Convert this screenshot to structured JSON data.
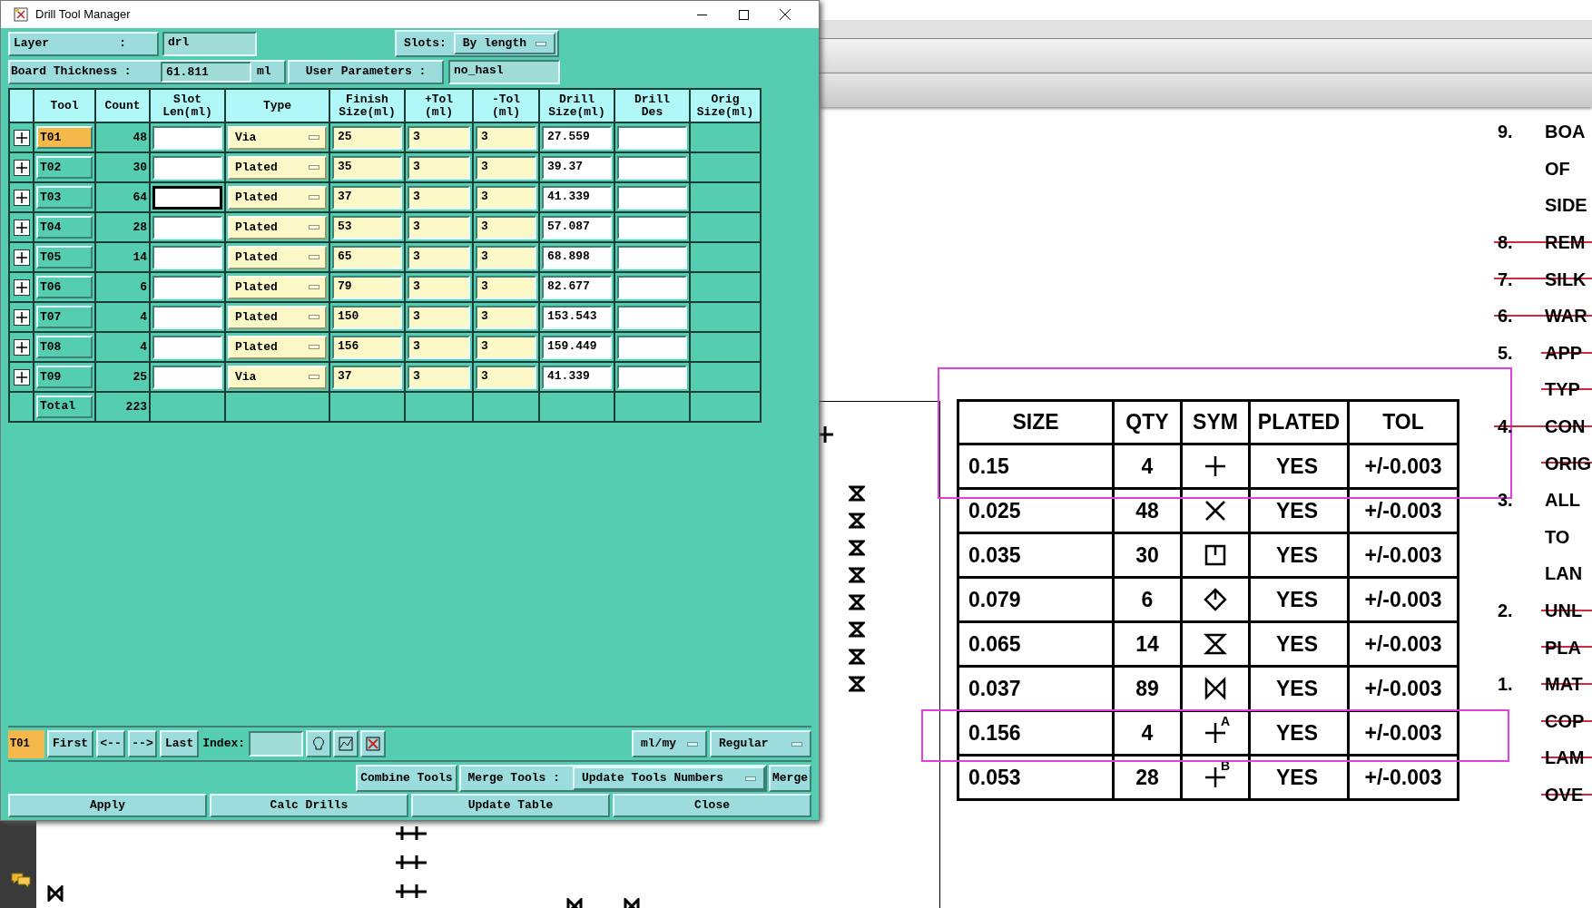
{
  "window": {
    "title": "Drill Tool Manager"
  },
  "layer": {
    "label": "Layer",
    "separator": ":",
    "value": "drl"
  },
  "slots": {
    "label": "Slots:",
    "value": "By length"
  },
  "board_thickness": {
    "label": "Board Thickness :",
    "value": "61.811",
    "unit": "ml"
  },
  "user_parameters": {
    "label": "User Parameters :",
    "value": "no_hasl"
  },
  "table": {
    "columns": [
      "Tool",
      "Count",
      "Slot\nLen(ml)",
      "Type",
      "Finish\nSize(ml)",
      "+Tol\n(ml)",
      "-Tol\n(ml)",
      "Drill\nSize(ml)",
      "Drill\nDes",
      "Orig\nSize(ml)"
    ],
    "rows": [
      {
        "tool": "T01",
        "selected": true,
        "count": "48",
        "slot_focused": false,
        "type": "Via",
        "finish": "25",
        "plus_tol": "3",
        "minus_tol": "3",
        "drill_size": "27.559"
      },
      {
        "tool": "T02",
        "selected": false,
        "count": "30",
        "slot_focused": false,
        "type": "Plated",
        "finish": "35",
        "plus_tol": "3",
        "minus_tol": "3",
        "drill_size": "39.37"
      },
      {
        "tool": "T03",
        "selected": false,
        "count": "64",
        "slot_focused": true,
        "type": "Plated",
        "finish": "37",
        "plus_tol": "3",
        "minus_tol": "3",
        "drill_size": "41.339"
      },
      {
        "tool": "T04",
        "selected": false,
        "count": "28",
        "slot_focused": false,
        "type": "Plated",
        "finish": "53",
        "plus_tol": "3",
        "minus_tol": "3",
        "drill_size": "57.087"
      },
      {
        "tool": "T05",
        "selected": false,
        "count": "14",
        "slot_focused": false,
        "type": "Plated",
        "finish": "65",
        "plus_tol": "3",
        "minus_tol": "3",
        "drill_size": "68.898"
      },
      {
        "tool": "T06",
        "selected": false,
        "count": "6",
        "slot_focused": false,
        "type": "Plated",
        "finish": "79",
        "plus_tol": "3",
        "minus_tol": "3",
        "drill_size": "82.677"
      },
      {
        "tool": "T07",
        "selected": false,
        "count": "4",
        "slot_focused": false,
        "type": "Plated",
        "finish": "150",
        "plus_tol": "3",
        "minus_tol": "3",
        "drill_size": "153.543"
      },
      {
        "tool": "T08",
        "selected": false,
        "count": "4",
        "slot_focused": false,
        "type": "Plated",
        "finish": "156",
        "plus_tol": "3",
        "minus_tol": "3",
        "drill_size": "159.449"
      },
      {
        "tool": "T09",
        "selected": false,
        "count": "25",
        "slot_focused": false,
        "type": "Via",
        "finish": "37",
        "plus_tol": "3",
        "minus_tol": "3",
        "drill_size": "41.339"
      }
    ],
    "total": {
      "label": "Total",
      "count": "223"
    }
  },
  "navigation": {
    "current_tool": "T01",
    "buttons": [
      "First",
      "<--",
      "-->",
      "Last"
    ],
    "index_label": "Index:",
    "units": "ml/my",
    "mode": "Regular"
  },
  "merge_row": {
    "combine": "Combine Tools",
    "merge_label": "Merge Tools :",
    "merge_option": "Update Tools Numbers",
    "merge": "Merge"
  },
  "actions": [
    "Apply",
    "Calc Drills",
    "Update Table",
    "Close"
  ],
  "document": {
    "drill_chart": {
      "columns": [
        "SIZE",
        "QTY",
        "SYM",
        "PLATED",
        "TOL"
      ],
      "rows": [
        {
          "size": "0.15",
          "qty": "4",
          "sym": {
            "kind": "plus"
          },
          "plated": "YES",
          "tol": "+/-0.003"
        },
        {
          "size": "0.025",
          "qty": "48",
          "sym": {
            "kind": "cross"
          },
          "plated": "YES",
          "tol": "+/-0.003"
        },
        {
          "size": "0.035",
          "qty": "30",
          "sym": {
            "kind": "square"
          },
          "plated": "YES",
          "tol": "+/-0.003"
        },
        {
          "size": "0.079",
          "qty": "6",
          "sym": {
            "kind": "diamond"
          },
          "plated": "YES",
          "tol": "+/-0.003"
        },
        {
          "size": "0.065",
          "qty": "14",
          "sym": {
            "kind": "hourglass"
          },
          "plated": "YES",
          "tol": "+/-0.003"
        },
        {
          "size": "0.037",
          "qty": "89",
          "sym": {
            "kind": "bowtie"
          },
          "plated": "YES",
          "tol": "+/-0.003"
        },
        {
          "size": "0.156",
          "qty": "4",
          "sym": {
            "kind": "plus_letter",
            "letter": "A"
          },
          "plated": "YES",
          "tol": "+/-0.003"
        },
        {
          "size": "0.053",
          "qty": "28",
          "sym": {
            "kind": "plus_letter",
            "letter": "B"
          },
          "plated": "YES",
          "tol": "+/-0.003"
        }
      ]
    },
    "notes": [
      {
        "number": "9.",
        "number_struck": false,
        "text": "BOA",
        "struck": false
      },
      {
        "text": "OF",
        "struck": false
      },
      {
        "text": "SIDE",
        "struck": false
      },
      {
        "number": "8.",
        "number_struck": true,
        "text": "REM",
        "struck": true
      },
      {
        "number": "7.",
        "number_struck": true,
        "text": "SILK",
        "struck": true
      },
      {
        "number": "6.",
        "number_struck": true,
        "text": "WAR",
        "struck": true
      },
      {
        "number": "5.",
        "number_struck": false,
        "text": "APP",
        "struck": true
      },
      {
        "text": "TYP",
        "struck": true
      },
      {
        "number": "4.",
        "number_struck": true,
        "text": "CON",
        "struck": true
      },
      {
        "text": "ORIG",
        "struck": true
      },
      {
        "number": "3.",
        "number_struck": false,
        "text": "ALL",
        "struck": false
      },
      {
        "text": "TO",
        "struck": false
      },
      {
        "text": "LAN",
        "struck": false
      },
      {
        "number": "2.",
        "number_struck": false,
        "text": "UNL",
        "struck": true
      },
      {
        "text": "PLA",
        "struck": true
      },
      {
        "number": "1.",
        "number_struck": false,
        "text": "MAT",
        "struck": true
      },
      {
        "text": "COP",
        "struck": true
      },
      {
        "text": "LAM",
        "struck": true
      },
      {
        "text": "OVE",
        "struck": true
      }
    ]
  }
}
